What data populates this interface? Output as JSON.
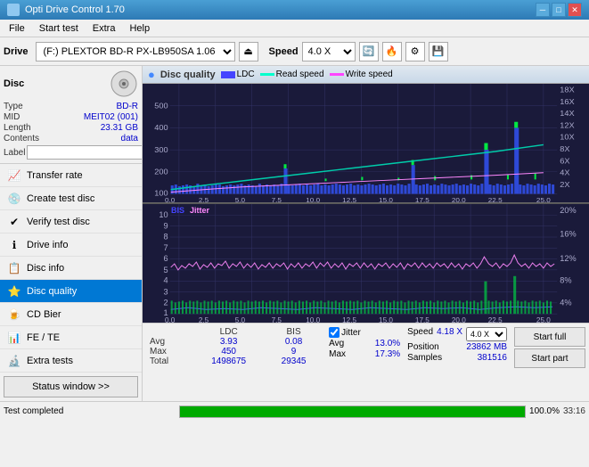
{
  "app": {
    "title": "Opti Drive Control 1.70",
    "icon": "disc-icon"
  },
  "titlebar": {
    "minimize": "─",
    "maximize": "□",
    "close": "✕"
  },
  "menu": {
    "items": [
      "File",
      "Start test",
      "Extra",
      "Help"
    ]
  },
  "toolbar": {
    "drive_label": "Drive",
    "drive_value": "(F:)  PLEXTOR BD-R  PX-LB950SA 1.06",
    "speed_label": "Speed",
    "speed_value": "4.0 X"
  },
  "disc": {
    "header": "Disc",
    "type_label": "Type",
    "type_value": "BD-R",
    "mid_label": "MID",
    "mid_value": "MEIT02 (001)",
    "length_label": "Length",
    "length_value": "23.31 GB",
    "contents_label": "Contents",
    "contents_value": "data",
    "label_label": "Label"
  },
  "nav": {
    "items": [
      {
        "id": "transfer-rate",
        "label": "Transfer rate",
        "icon": "📈"
      },
      {
        "id": "create-test-disc",
        "label": "Create test disc",
        "icon": "💿"
      },
      {
        "id": "verify-test-disc",
        "label": "Verify test disc",
        "icon": "✔️"
      },
      {
        "id": "drive-info",
        "label": "Drive info",
        "icon": "ℹ️"
      },
      {
        "id": "disc-info",
        "label": "Disc info",
        "icon": "📋"
      },
      {
        "id": "disc-quality",
        "label": "Disc quality",
        "icon": "⭐",
        "active": true
      },
      {
        "id": "cd-bier",
        "label": "CD Bier",
        "icon": "🍺"
      },
      {
        "id": "fe-te",
        "label": "FE / TE",
        "icon": "📊"
      },
      {
        "id": "extra-tests",
        "label": "Extra tests",
        "icon": "🔬"
      }
    ],
    "status_btn": "Status window >>"
  },
  "chart": {
    "title": "Disc quality",
    "legends": [
      {
        "id": "ldc",
        "label": "LDC",
        "color": "#4444ff"
      },
      {
        "id": "read-speed",
        "label": "Read speed",
        "color": "#00ffcc"
      },
      {
        "id": "write-speed",
        "label": "Write speed",
        "color": "#ff44ff"
      }
    ],
    "top_ymax": 500,
    "top_yticks": [
      500,
      400,
      300,
      200,
      100
    ],
    "top_right_yticks": [
      "18X",
      "16X",
      "14X",
      "12X",
      "10X",
      "8X",
      "6X",
      "4X",
      "2X"
    ],
    "bottom_legends": [
      {
        "id": "bis",
        "label": "BIS",
        "color": "#4444ff"
      },
      {
        "id": "jitter",
        "label": "Jitter",
        "color": "#ff44ff"
      }
    ],
    "bottom_yticks": [
      10,
      9,
      8,
      7,
      6,
      5,
      4,
      3,
      2,
      1
    ],
    "bottom_right_yticks": [
      "20%",
      "16%",
      "12%",
      "8%",
      "4%"
    ],
    "xticks": [
      "0.0",
      "2.5",
      "5.0",
      "7.5",
      "10.0",
      "12.5",
      "15.0",
      "17.5",
      "20.0",
      "22.5",
      "25.0"
    ]
  },
  "stats": {
    "columns": [
      "LDC",
      "BIS"
    ],
    "rows": [
      {
        "label": "Avg",
        "ldc": "3.93",
        "bis": "0.08"
      },
      {
        "label": "Max",
        "ldc": "450",
        "bis": "9"
      },
      {
        "label": "Total",
        "ldc": "1498675",
        "bis": "29345"
      }
    ],
    "jitter_label": "Jitter",
    "jitter_avg": "13.0%",
    "jitter_max": "17.3%",
    "jitter_total": "",
    "speed_label": "Speed",
    "speed_value": "4.18 X",
    "speed_select": "4.0 X",
    "position_label": "Position",
    "position_value": "23862 MB",
    "samples_label": "Samples",
    "samples_value": "381516",
    "btn_start_full": "Start full",
    "btn_start_part": "Start part"
  },
  "statusbar": {
    "text": "Test completed",
    "progress": 100,
    "progress_text": "100.0%",
    "time": "33:16"
  }
}
